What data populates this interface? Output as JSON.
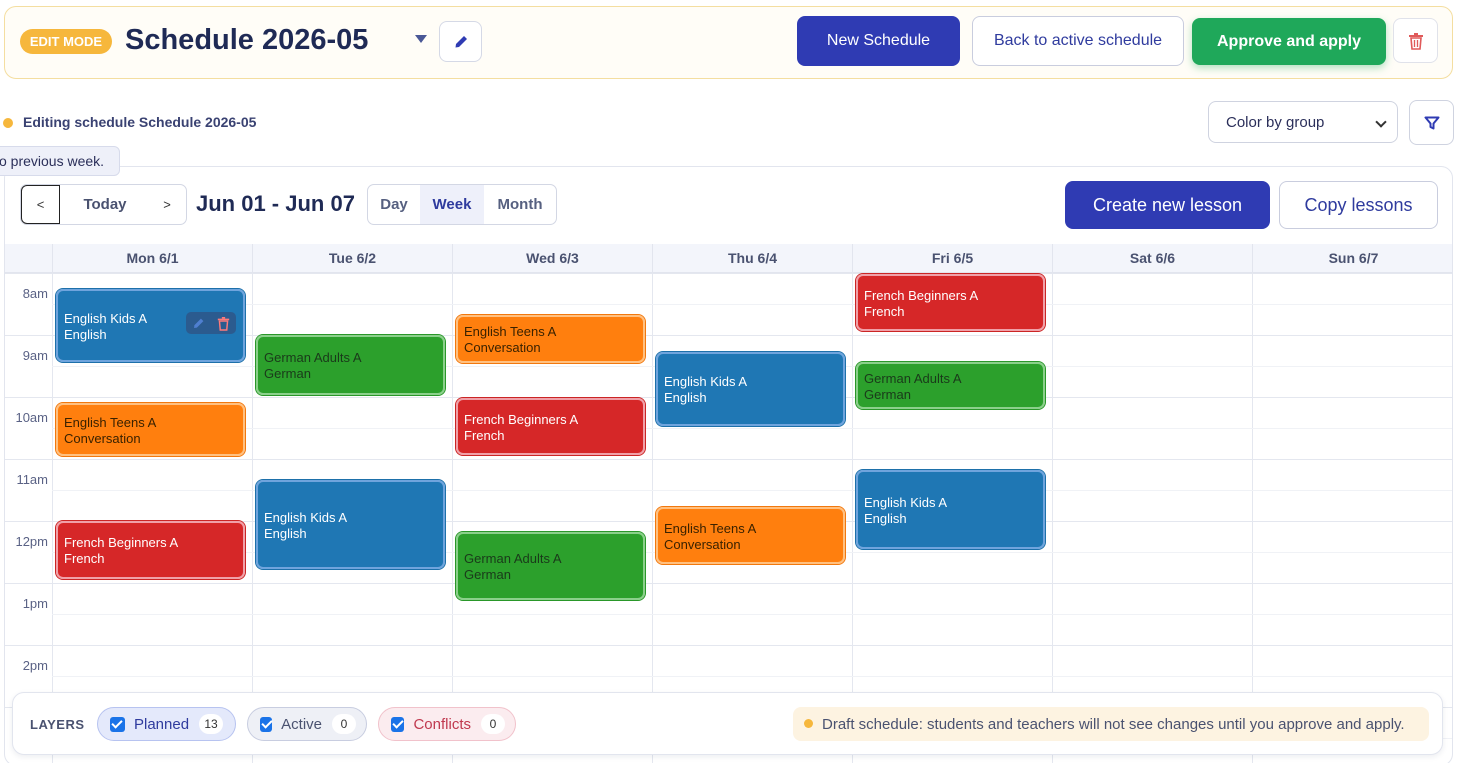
{
  "header": {
    "badge": "EDIT MODE",
    "title": "Schedule 2026-05",
    "buttons": {
      "new_schedule": "New Schedule",
      "back": "Back to active schedule",
      "approve": "Approve and apply"
    }
  },
  "status": {
    "text": "Editing schedule Schedule 2026-05",
    "color_select": "Color by group"
  },
  "tooltip": "o previous week.",
  "calendar": {
    "nav": {
      "prev": "<",
      "today": "Today",
      "next": ">"
    },
    "range": "Jun 01 - Jun 07",
    "views": [
      "Day",
      "Week",
      "Month"
    ],
    "active_view": "Week",
    "create_label": "Create new lesson",
    "copy_label": "Copy lessons",
    "days": [
      "Mon 6/1",
      "Tue 6/2",
      "Wed 6/3",
      "Thu 6/4",
      "Fri 6/5",
      "Sat 6/6",
      "Sun 6/7"
    ],
    "hours": [
      "8am",
      "9am",
      "10am",
      "11am",
      "12pm",
      "1pm",
      "2pm"
    ],
    "events": [
      {
        "day": 0,
        "group": "English Kids A",
        "subject": "English",
        "color": "blue"
      },
      {
        "day": 0,
        "group": "English Teens A",
        "subject": "Conversation",
        "color": "orange"
      },
      {
        "day": 0,
        "group": "French Beginners A",
        "subject": "French",
        "color": "red"
      },
      {
        "day": 1,
        "group": "German Adults A",
        "subject": "German",
        "color": "green"
      },
      {
        "day": 1,
        "group": "English Kids A",
        "subject": "English",
        "color": "blue"
      },
      {
        "day": 2,
        "group": "English Teens A",
        "subject": "Conversation",
        "color": "orange"
      },
      {
        "day": 2,
        "group": "French Beginners A",
        "subject": "French",
        "color": "red"
      },
      {
        "day": 2,
        "group": "German Adults A",
        "subject": "German",
        "color": "green"
      },
      {
        "day": 3,
        "group": "English Kids A",
        "subject": "English",
        "color": "blue"
      },
      {
        "day": 3,
        "group": "English Teens A",
        "subject": "Conversation",
        "color": "orange"
      },
      {
        "day": 4,
        "group": "French Beginners A",
        "subject": "French",
        "color": "red"
      },
      {
        "day": 4,
        "group": "German Adults A",
        "subject": "German",
        "color": "green"
      },
      {
        "day": 4,
        "group": "English Kids A",
        "subject": "English",
        "color": "blue"
      }
    ]
  },
  "layers": {
    "label": "LAYERS",
    "planned": {
      "label": "Planned",
      "count": "13"
    },
    "active": {
      "label": "Active",
      "count": "0"
    },
    "conflicts": {
      "label": "Conflicts",
      "count": "0"
    },
    "draft_note": "Draft schedule: students and teachers will not see changes until you approve and apply."
  },
  "colors": {
    "primary": "#2f3bb3",
    "approve": "#1fa85a",
    "edit_badge": "#f6b73c",
    "event_blue": "#1f77b4",
    "event_green": "#2ca02c",
    "event_orange": "#ff7f0e",
    "event_red": "#d62728"
  }
}
